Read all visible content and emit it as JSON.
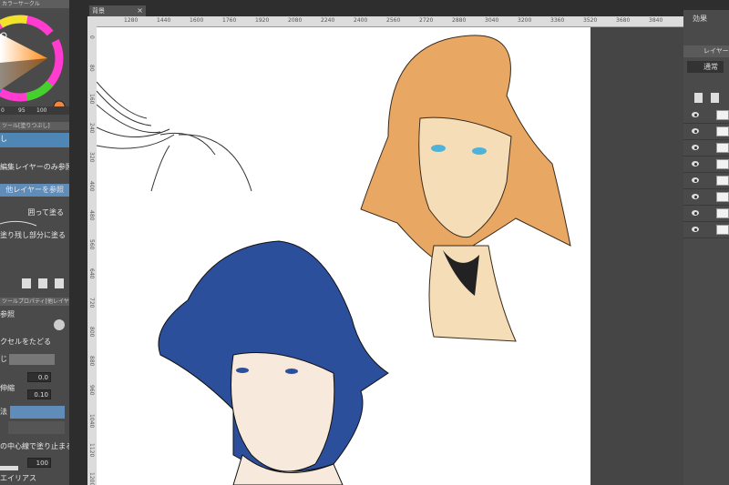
{
  "left_panel": {
    "color_header": "カラーサークル",
    "hsv": {
      "h": "0",
      "s": "95",
      "v": "100"
    },
    "tool_header": "ツール[塗りつぶし]",
    "tool_tab": "し",
    "fill_refs": [
      {
        "label": "編集レイヤーのみ参照"
      },
      {
        "label": "他レイヤーを参照"
      },
      {
        "label": "囲って塗る"
      },
      {
        "label": "塗り残し部分に塗る"
      }
    ],
    "prop_header": "ツールプロパティ[他レイヤーを参",
    "ref_label": "参照",
    "follow_pixel": "クセルをたどる",
    "close_label": "じ",
    "value_0": "0.0",
    "shrink_label": "伸縮",
    "value_1": "0.10",
    "method_label": "法",
    "center_label": "の中心線で塗り止まる",
    "opacity_value": "100",
    "antialias_label": "エイリアス"
  },
  "canvas": {
    "tab_title": "背景",
    "ruler_ticks": [
      "1280",
      "1440",
      "1600",
      "1760",
      "1920",
      "2080",
      "2240",
      "2400",
      "2560",
      "2720",
      "2880",
      "3040",
      "3200",
      "3360",
      "3520",
      "3680",
      "3840"
    ],
    "ruler_v_ticks": [
      "0",
      "80",
      "160",
      "240",
      "320",
      "400",
      "480",
      "560",
      "640",
      "720",
      "800",
      "880",
      "960",
      "1040",
      "1120",
      "1200"
    ]
  },
  "right_panel": {
    "effect_label": "効果",
    "layer_tab": "レイヤー",
    "blend_mode": "通常"
  },
  "colors": {
    "accent": "#5f8cb8",
    "orange_hair": "#e8a864",
    "blue_hair": "#2c4f9c"
  }
}
